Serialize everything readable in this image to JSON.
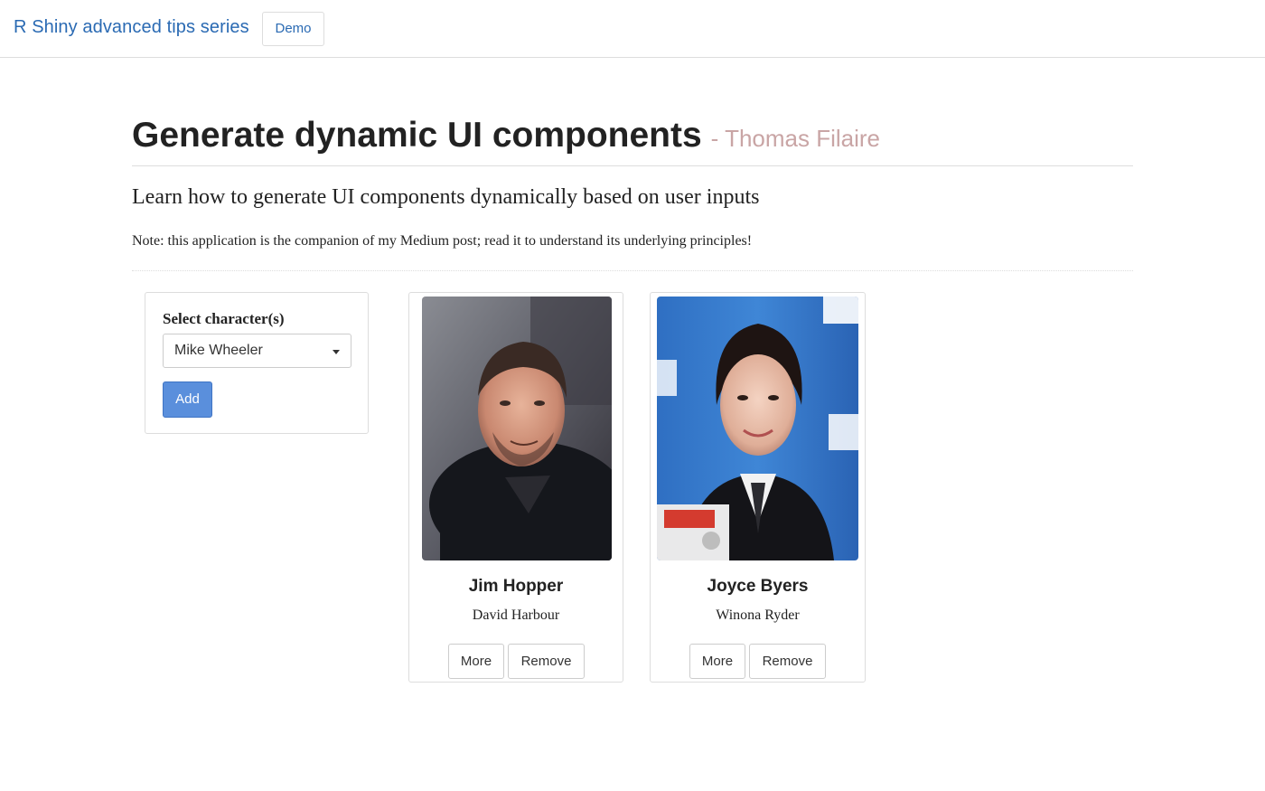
{
  "navbar": {
    "brand": "R Shiny advanced tips series",
    "tabs": [
      {
        "label": "Demo",
        "active": true
      }
    ],
    "accent_color": "#2a6ab3"
  },
  "header": {
    "title": "Generate dynamic UI components",
    "author": "- Thomas Filaire",
    "subtitle": "Learn how to generate UI components dynamically based on user inputs",
    "note": "Note: this application is the companion of my Medium post; read it to understand its underlying principles!"
  },
  "sidebar": {
    "select_label": "Select character(s)",
    "select_value": "Mike Wheeler",
    "add_button": "Add",
    "button_color": "#5a8fdc"
  },
  "cards": [
    {
      "character": "Jim Hopper",
      "actor": "David Harbour",
      "more_label": "More",
      "remove_label": "Remove"
    },
    {
      "character": "Joyce Byers",
      "actor": "Winona Ryder",
      "more_label": "More",
      "remove_label": "Remove"
    }
  ]
}
